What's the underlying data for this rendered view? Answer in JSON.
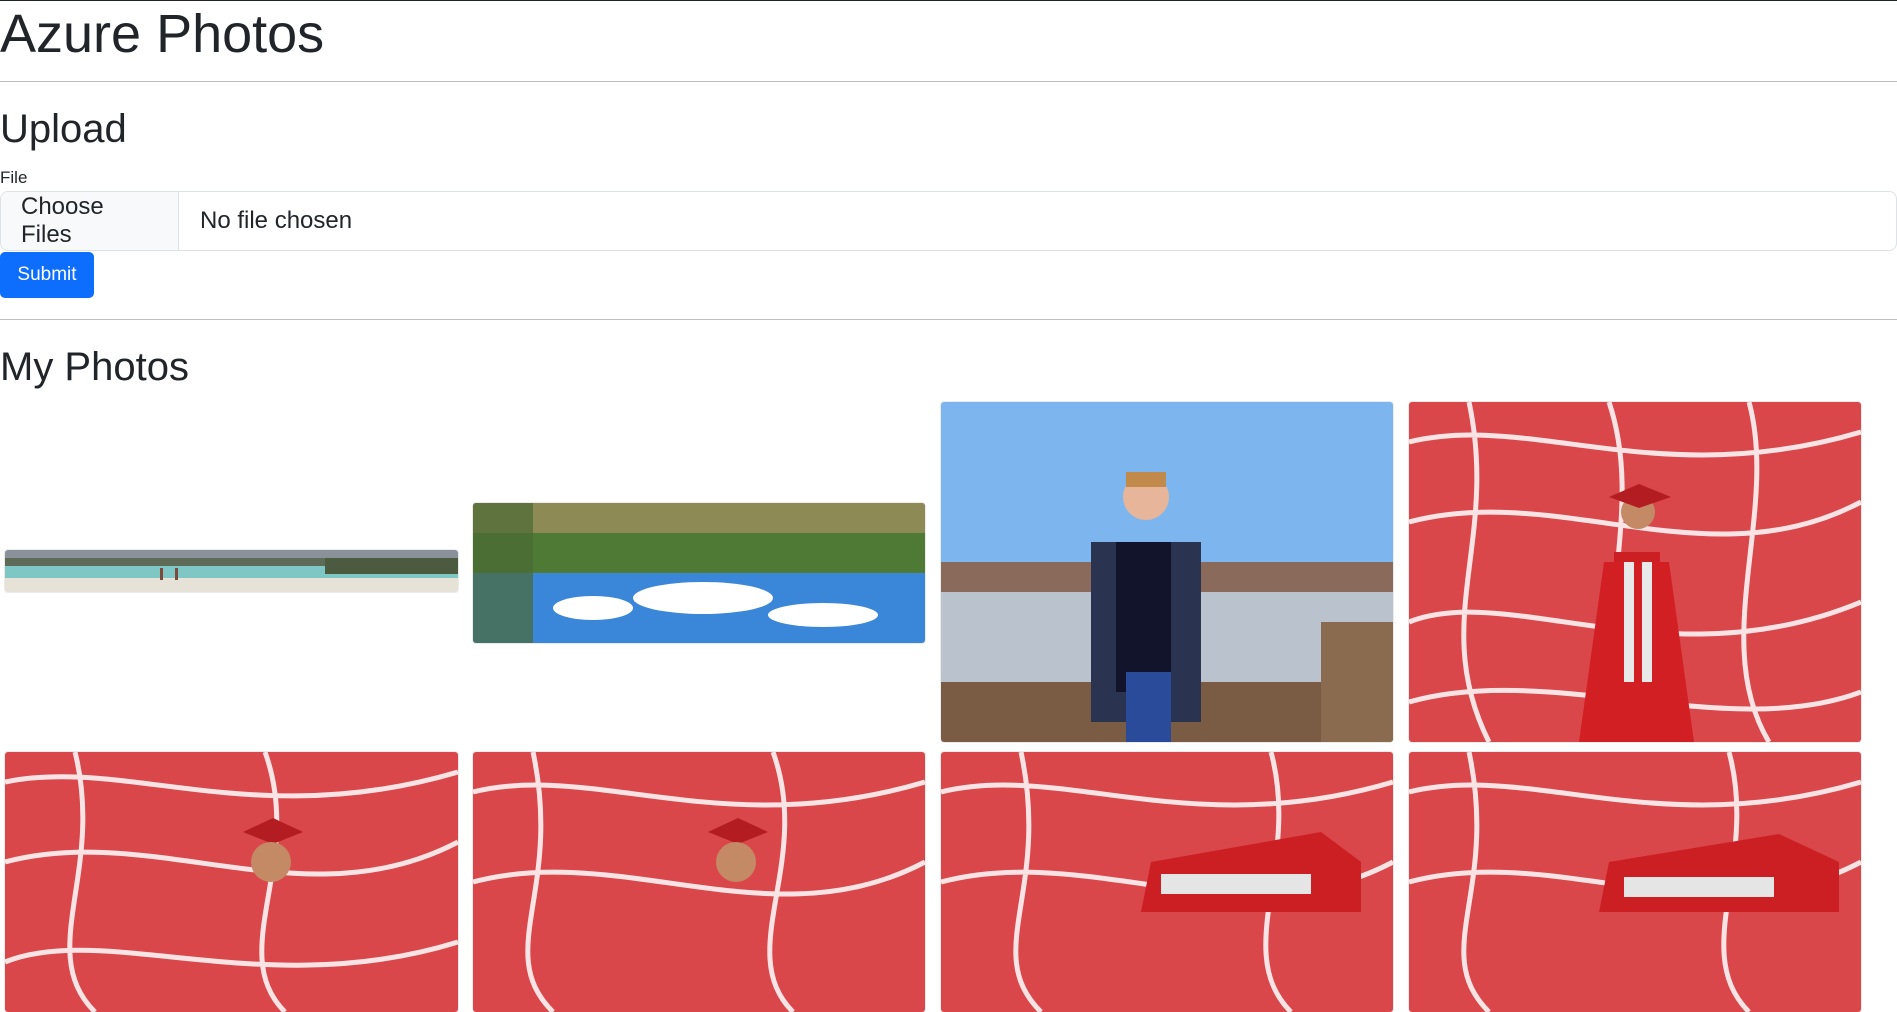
{
  "app": {
    "title": "Azure Photos"
  },
  "upload": {
    "heading": "Upload",
    "file_label": "File",
    "choose_button": "Choose Files",
    "file_status": "No file chosen",
    "submit_label": "Submit"
  },
  "gallery": {
    "heading": "My Photos",
    "photos": [
      {
        "subject": "beach-panorama"
      },
      {
        "subject": "upside-down-reflection"
      },
      {
        "subject": "man-on-dock"
      },
      {
        "subject": "graduate-red-gown"
      },
      {
        "subject": "graduate-red-gown"
      },
      {
        "subject": "graduate-red-gown"
      },
      {
        "subject": "graduate-red-gown"
      },
      {
        "subject": "graduate-red-gown"
      }
    ]
  },
  "colors": {
    "accent": "#0d6efd",
    "text": "#212529"
  }
}
